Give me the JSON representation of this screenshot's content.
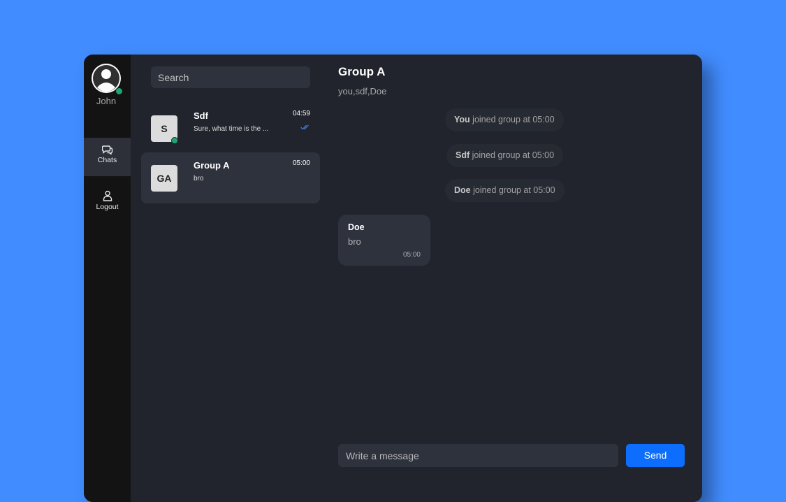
{
  "rail": {
    "user_name": "John",
    "items": [
      {
        "label": "Chats",
        "icon": "chats-icon"
      },
      {
        "label": "Logout",
        "icon": "user-icon"
      }
    ]
  },
  "search": {
    "placeholder": "Search"
  },
  "chats": [
    {
      "initials": "S",
      "name": "Sdf",
      "preview": "Sure, what time is the ...",
      "time": "04:59",
      "online": true,
      "read": true
    },
    {
      "initials": "GA",
      "name": "Group A",
      "preview": "bro",
      "time": "05:00",
      "online": false,
      "active": true
    }
  ],
  "conversation": {
    "title": "Group A",
    "members": "you,sdf,Doe",
    "system_messages": [
      {
        "who": "You",
        "text": " joined group at 05:00"
      },
      {
        "who": "Sdf",
        "text": " joined group at 05:00"
      },
      {
        "who": "Doe",
        "text": " joined group at 05:00"
      }
    ],
    "messages": [
      {
        "sender": "Doe",
        "text": "bro",
        "time": "05:00"
      }
    ]
  },
  "composer": {
    "placeholder": "Write a message",
    "send_label": "Send"
  },
  "colors": {
    "background": "#418cfe",
    "online": "#1ea672",
    "accent": "#0d6efd",
    "read_tick": "#3b82f6"
  }
}
